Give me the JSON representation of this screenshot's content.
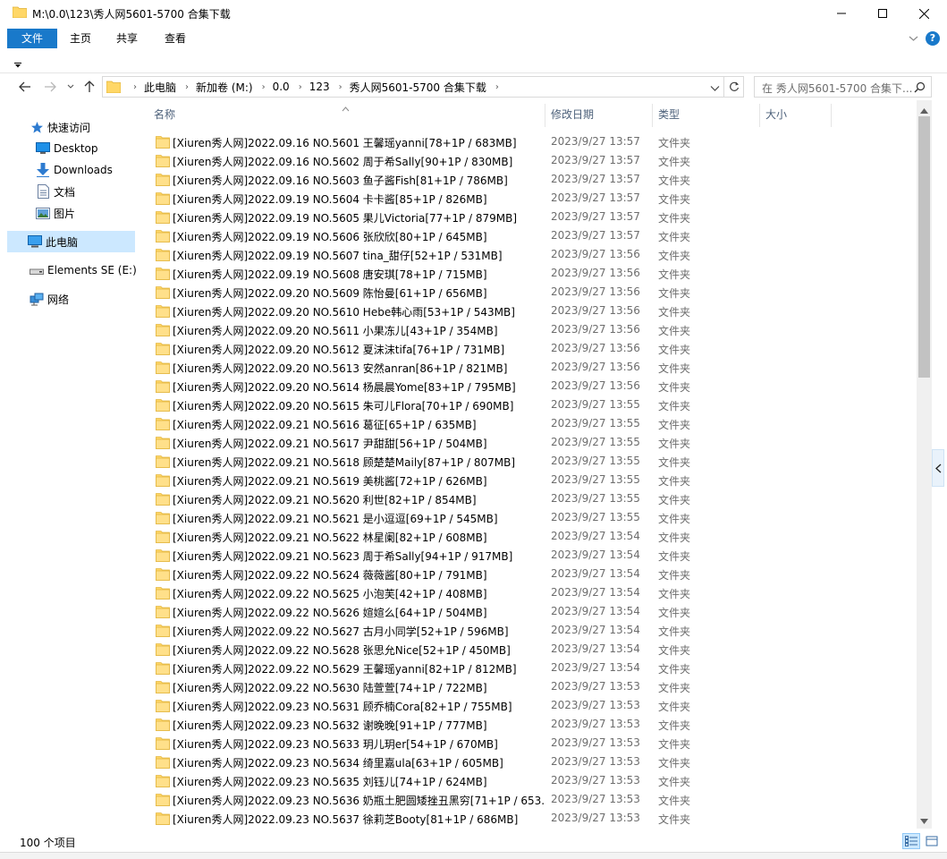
{
  "window": {
    "title": "M:\\0.0\\123\\秀人网5601-5700 合集下载"
  },
  "ribbon": {
    "tabs": [
      {
        "label": "文件",
        "active": true
      },
      {
        "label": "主页",
        "active": false
      },
      {
        "label": "共享",
        "active": false
      },
      {
        "label": "查看",
        "active": false
      }
    ],
    "help_label": "?"
  },
  "address": {
    "crumbs": [
      "此电脑",
      "新加卷 (M:)",
      "0.0",
      "123",
      "秀人网5601-5700 合集下载"
    ],
    "search_placeholder": "在 秀人网5601-5700 合集下..."
  },
  "nav": {
    "items": [
      {
        "label": "快速访问",
        "icon": "star-icon"
      },
      {
        "label": "Desktop",
        "icon": "desktop-icon",
        "pinned": true
      },
      {
        "label": "Downloads",
        "icon": "download-icon",
        "pinned": true
      },
      {
        "label": "文档",
        "icon": "document-icon",
        "pinned": true
      },
      {
        "label": "图片",
        "icon": "pictures-icon",
        "pinned": true
      },
      {
        "label": "此电脑",
        "icon": "computer-icon",
        "selected": true
      },
      {
        "label": "Elements SE (E:)",
        "icon": "drive-icon"
      },
      {
        "label": "网络",
        "icon": "network-icon"
      }
    ]
  },
  "columns": {
    "name": "名称",
    "date": "修改日期",
    "type": "类型",
    "size": "大小"
  },
  "files": [
    {
      "name": "[Xiuren秀人网]2022.09.16 NO.5601 王馨瑶yanni[78+1P / 683MB]",
      "date": "2023/9/27 13:57",
      "type": "文件夹"
    },
    {
      "name": "[Xiuren秀人网]2022.09.16 NO.5602 周于希Sally[90+1P / 830MB]",
      "date": "2023/9/27 13:57",
      "type": "文件夹"
    },
    {
      "name": "[Xiuren秀人网]2022.09.16 NO.5603 鱼子酱Fish[81+1P / 786MB]",
      "date": "2023/9/27 13:57",
      "type": "文件夹"
    },
    {
      "name": "[Xiuren秀人网]2022.09.19 NO.5604 卡卡酱[85+1P / 826MB]",
      "date": "2023/9/27 13:57",
      "type": "文件夹"
    },
    {
      "name": "[Xiuren秀人网]2022.09.19 NO.5605 果儿Victoria[77+1P / 879MB]",
      "date": "2023/9/27 13:57",
      "type": "文件夹"
    },
    {
      "name": "[Xiuren秀人网]2022.09.19 NO.5606 张欣欣[80+1P / 645MB]",
      "date": "2023/9/27 13:57",
      "type": "文件夹"
    },
    {
      "name": "[Xiuren秀人网]2022.09.19 NO.5607 tina_甜仔[52+1P / 531MB]",
      "date": "2023/9/27 13:56",
      "type": "文件夹"
    },
    {
      "name": "[Xiuren秀人网]2022.09.19 NO.5608 唐安琪[78+1P / 715MB]",
      "date": "2023/9/27 13:56",
      "type": "文件夹"
    },
    {
      "name": "[Xiuren秀人网]2022.09.20 NO.5609 陈怡曼[61+1P / 656MB]",
      "date": "2023/9/27 13:56",
      "type": "文件夹"
    },
    {
      "name": "[Xiuren秀人网]2022.09.20 NO.5610 Hebe韩心雨[53+1P / 543MB]",
      "date": "2023/9/27 13:56",
      "type": "文件夹"
    },
    {
      "name": "[Xiuren秀人网]2022.09.20 NO.5611 小果冻儿[43+1P / 354MB]",
      "date": "2023/9/27 13:56",
      "type": "文件夹"
    },
    {
      "name": "[Xiuren秀人网]2022.09.20 NO.5612 夏沫沫tifa[76+1P / 731MB]",
      "date": "2023/9/27 13:56",
      "type": "文件夹"
    },
    {
      "name": "[Xiuren秀人网]2022.09.20 NO.5613 安然anran[86+1P / 821MB]",
      "date": "2023/9/27 13:56",
      "type": "文件夹"
    },
    {
      "name": "[Xiuren秀人网]2022.09.20 NO.5614 杨晨晨Yome[83+1P / 795MB]",
      "date": "2023/9/27 13:56",
      "type": "文件夹"
    },
    {
      "name": "[Xiuren秀人网]2022.09.20 NO.5615 朱可儿Flora[70+1P / 690MB]",
      "date": "2023/9/27 13:55",
      "type": "文件夹"
    },
    {
      "name": "[Xiuren秀人网]2022.09.21 NO.5616 葛征[65+1P / 635MB]",
      "date": "2023/9/27 13:55",
      "type": "文件夹"
    },
    {
      "name": "[Xiuren秀人网]2022.09.21 NO.5617 尹甜甜[56+1P / 504MB]",
      "date": "2023/9/27 13:55",
      "type": "文件夹"
    },
    {
      "name": "[Xiuren秀人网]2022.09.21 NO.5618 顾楚楚Maily[87+1P / 807MB]",
      "date": "2023/9/27 13:55",
      "type": "文件夹"
    },
    {
      "name": "[Xiuren秀人网]2022.09.21 NO.5619 美桃酱[72+1P / 626MB]",
      "date": "2023/9/27 13:55",
      "type": "文件夹"
    },
    {
      "name": "[Xiuren秀人网]2022.09.21 NO.5620 利世[82+1P / 854MB]",
      "date": "2023/9/27 13:55",
      "type": "文件夹"
    },
    {
      "name": "[Xiuren秀人网]2022.09.21 NO.5621 是小逗逗[69+1P / 545MB]",
      "date": "2023/9/27 13:55",
      "type": "文件夹"
    },
    {
      "name": "[Xiuren秀人网]2022.09.21 NO.5622 林星阑[82+1P / 608MB]",
      "date": "2023/9/27 13:54",
      "type": "文件夹"
    },
    {
      "name": "[Xiuren秀人网]2022.09.21 NO.5623 周于希Sally[94+1P / 917MB]",
      "date": "2023/9/27 13:54",
      "type": "文件夹"
    },
    {
      "name": "[Xiuren秀人网]2022.09.22 NO.5624 薇薇酱[80+1P / 791MB]",
      "date": "2023/9/27 13:54",
      "type": "文件夹"
    },
    {
      "name": "[Xiuren秀人网]2022.09.22 NO.5625 小泡芙[42+1P / 408MB]",
      "date": "2023/9/27 13:54",
      "type": "文件夹"
    },
    {
      "name": "[Xiuren秀人网]2022.09.22 NO.5626 媗媗么[64+1P / 504MB]",
      "date": "2023/9/27 13:54",
      "type": "文件夹"
    },
    {
      "name": "[Xiuren秀人网]2022.09.22 NO.5627 古月小同学[52+1P / 596MB]",
      "date": "2023/9/27 13:54",
      "type": "文件夹"
    },
    {
      "name": "[Xiuren秀人网]2022.09.22 NO.5628 张思允Nice[52+1P / 450MB]",
      "date": "2023/9/27 13:54",
      "type": "文件夹"
    },
    {
      "name": "[Xiuren秀人网]2022.09.22 NO.5629 王馨瑶yanni[82+1P / 812MB]",
      "date": "2023/9/27 13:54",
      "type": "文件夹"
    },
    {
      "name": "[Xiuren秀人网]2022.09.22 NO.5630 陆萱萱[74+1P / 722MB]",
      "date": "2023/9/27 13:53",
      "type": "文件夹"
    },
    {
      "name": "[Xiuren秀人网]2022.09.23 NO.5631 顾乔楠Cora[82+1P / 755MB]",
      "date": "2023/9/27 13:53",
      "type": "文件夹"
    },
    {
      "name": "[Xiuren秀人网]2022.09.23 NO.5632 谢晚晚[91+1P / 777MB]",
      "date": "2023/9/27 13:53",
      "type": "文件夹"
    },
    {
      "name": "[Xiuren秀人网]2022.09.23 NO.5633 玥儿玥er[54+1P / 670MB]",
      "date": "2023/9/27 13:53",
      "type": "文件夹"
    },
    {
      "name": "[Xiuren秀人网]2022.09.23 NO.5634 绮里嘉ula[63+1P / 605MB]",
      "date": "2023/9/27 13:53",
      "type": "文件夹"
    },
    {
      "name": "[Xiuren秀人网]2022.09.23 NO.5635 刘钰儿[74+1P / 624MB]",
      "date": "2023/9/27 13:53",
      "type": "文件夹"
    },
    {
      "name": "[Xiuren秀人网]2022.09.23 NO.5636 奶瓶土肥圆矮挫丑黑穷[71+1P / 653...",
      "date": "2023/9/27 13:53",
      "type": "文件夹"
    },
    {
      "name": "[Xiuren秀人网]2022.09.23 NO.5637 徐莉芝Booty[81+1P / 686MB]",
      "date": "2023/9/27 13:53",
      "type": "文件夹"
    }
  ],
  "status": {
    "item_count": "100 个项目"
  },
  "colors": {
    "accent": "#1979ca",
    "folder": "#ffd767",
    "selection": "#cce8ff"
  }
}
